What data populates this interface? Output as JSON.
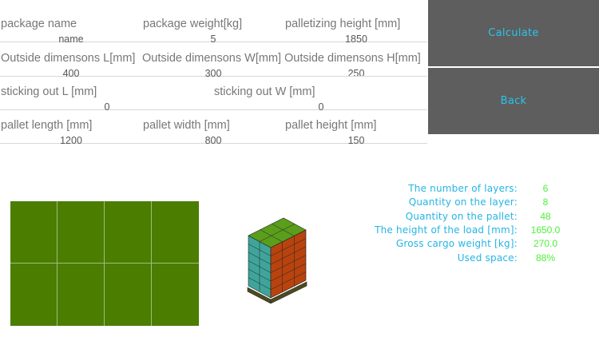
{
  "inputs": {
    "row1": {
      "package_name": {
        "label": "package name",
        "value": "name"
      },
      "package_weight": {
        "label": "package weight[kg]",
        "value": "5"
      },
      "palletizing_height": {
        "label": "palletizing height [mm]",
        "value": "1850"
      }
    },
    "row2": {
      "outside_l": {
        "label": "Outside dimensons L[mm]",
        "value": "400"
      },
      "outside_w": {
        "label": "Outside dimensons W[mm]",
        "value": "300"
      },
      "outside_h": {
        "label": "Outside dimensons H[mm]",
        "value": "250"
      }
    },
    "row3": {
      "sticking_l": {
        "label": "sticking out L [mm]",
        "value": "0"
      },
      "sticking_w": {
        "label": "sticking out W [mm]",
        "value": "0"
      }
    },
    "row4": {
      "pallet_length": {
        "label": "pallet length [mm]",
        "value": "1200"
      },
      "pallet_width": {
        "label": "pallet width [mm]",
        "value": "800"
      },
      "pallet_height": {
        "label": "pallet height [mm]",
        "value": "150"
      }
    }
  },
  "buttons": {
    "calculate": "Calculate",
    "back": "Back"
  },
  "layer_layout": {
    "columns": 4,
    "rows": 2,
    "color": "#4b7d00",
    "grid_color": "#9fc07a"
  },
  "stack_visual": {
    "side_color": "#3fa59a",
    "front_color": "#b8430f",
    "top_color": "#5a9e1c",
    "pallet_color": "#4b4b1e"
  },
  "results": [
    {
      "label": "The number of layers:",
      "value": "6"
    },
    {
      "label": "Quantity on the layer:",
      "value": "8"
    },
    {
      "label": "Quantity on the pallet:",
      "value": "48"
    },
    {
      "label": "The height of the load [mm]:",
      "value": "1650.0"
    },
    {
      "label": "Gross cargo weight [kg]:",
      "value": "270.0"
    },
    {
      "label": "Used space:",
      "value": "88%"
    }
  ],
  "colors": {
    "button_bg": "#5e5e5e",
    "button_text": "#29c4ec",
    "result_label": "#25b5e4",
    "result_value": "#4ef03a"
  }
}
